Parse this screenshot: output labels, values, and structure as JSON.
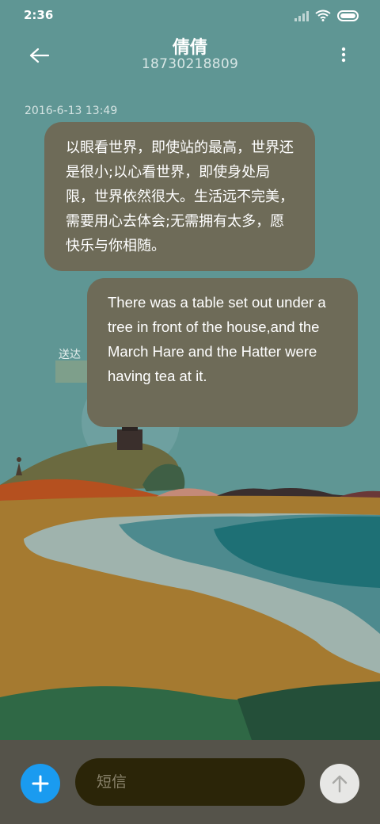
{
  "status_bar": {
    "time": "2:36",
    "icons": [
      "signal-icon",
      "wifi-icon",
      "battery-icon"
    ]
  },
  "header": {
    "back_icon": "arrow-left-icon",
    "contact_name": "倩倩",
    "contact_number": "18730218809",
    "more_icon": "more-vertical-icon"
  },
  "conversation": {
    "timestamp": "2016-6-13 13:49",
    "messages": [
      {
        "direction": "incoming",
        "text": "以眼看世界，即使站的最高，世界还是很小;以心看世界，即使身处局限，世界依然很大。生活远不完美，需要用心去体会;无需拥有太多，愿快乐与你相随。"
      },
      {
        "direction": "outgoing",
        "text": "There was a table set out under a tree in front of the house,and the March Hare and the Hatter were having tea at it.",
        "status": "送达"
      }
    ]
  },
  "composer": {
    "add_icon": "plus-icon",
    "placeholder": "短信",
    "value": "",
    "send_icon": "arrow-up-icon"
  },
  "colors": {
    "sky": "#5f9694",
    "bubble": "#6e6b58",
    "input_bar": "#55534a",
    "add_button": "#1a9bf0",
    "send_button": "#e7e7e5"
  }
}
